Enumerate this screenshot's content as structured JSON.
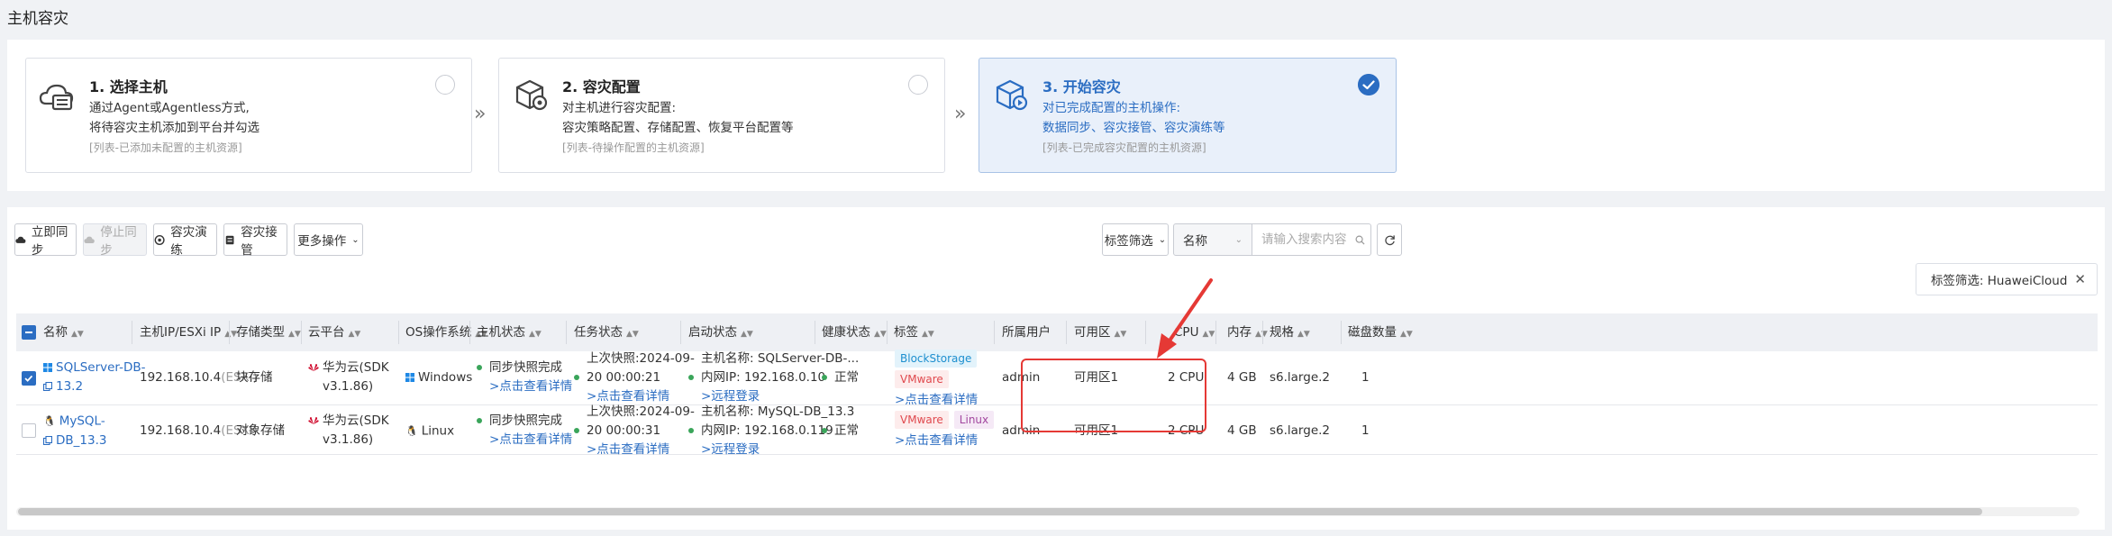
{
  "page_title": "主机容灾",
  "steps": [
    {
      "title": "1. 选择主机",
      "desc_lines": [
        "通过Agent或Agentless方式,",
        "将待容灾主机添加到平台并勾选"
      ],
      "note": "[列表-已添加未配置的主机资源]",
      "icon": "cloud-host-icon",
      "state": "unselected"
    },
    {
      "title": "2. 容灾配置",
      "desc_lines": [
        "对主机进行容灾配置:",
        "容灾策略配置、存储配置、恢复平台配置等"
      ],
      "note": "[列表-待操作配置的主机资源]",
      "icon": "box-gear-icon",
      "state": "unselected"
    },
    {
      "title": "3. 开始容灾",
      "desc_lines": [
        "对已完成配置的主机操作:",
        "数据同步、容灾接管、容灾演练等"
      ],
      "note": "[列表-已完成容灾配置的主机资源]",
      "icon": "box-play-icon",
      "state": "selected"
    }
  ],
  "toolbar": {
    "sync_now": "立即同步",
    "stop_sync": "停止同步",
    "dr_drill": "容灾演练",
    "dr_takeover": "容灾接管",
    "more_actions": "更多操作",
    "tag_filter": "标签筛选",
    "search_field": "名称",
    "search_placeholder": "请输入搜索内容",
    "tag_chip": "标签筛选:  HuaweiCloud"
  },
  "table": {
    "headers": {
      "name": "名称",
      "ip": "主机IP/ESXi IP",
      "storage": "存储类型",
      "cloud": "云平台",
      "os": "OS操作系统",
      "host_status": "主机状态",
      "task_status": "任务状态",
      "boot_status": "启动状态",
      "health": "健康状态",
      "tags": "标签",
      "owner": "所属用户",
      "zone": "可用区",
      "cpu": "CPU",
      "memory": "内存",
      "spec": "规格",
      "disks": "磁盘数量"
    },
    "rows": [
      {
        "checked": true,
        "name_line1": "SQLServer-DB-",
        "name_line2": "13.2",
        "ip": "192.168.10.4",
        "ip_suffix": "(ESXi)",
        "storage": "块存储",
        "cloud_line1": "华为云(SDK",
        "cloud_line2": "v3.1.86)",
        "os": "Windows",
        "host_status": "同步快照完成",
        "host_detail": ">点击查看详情",
        "task_line1": "上次快照:2024-09-",
        "task_line2": "20 00:00:21",
        "task_detail": ">点击查看详情",
        "boot_name": "主机名称: SQLServer-DB-...",
        "boot_ip": "内网IP: 192.168.0.10",
        "boot_link": ">远程登录",
        "health": "正常",
        "tags": [
          "BlockStorage",
          "VMware"
        ],
        "tags_detail": ">点击查看详情",
        "owner": "admin",
        "zone": "可用区1",
        "cpu": "2 CPU",
        "memory": "4 GB",
        "spec": "s6.large.2",
        "disks": "1"
      },
      {
        "checked": false,
        "name_line1": "MySQL-",
        "name_line2": "DB_13.3",
        "ip": "192.168.10.4",
        "ip_suffix": "(ESXi)",
        "storage": "对象存储",
        "cloud_line1": "华为云(SDK",
        "cloud_line2": "v3.1.86)",
        "os": "Linux",
        "host_status": "同步快照完成",
        "host_detail": ">点击查看详情",
        "task_line1": "上次快照:2024-09-",
        "task_line2": "20 00:00:31",
        "task_detail": ">点击查看详情",
        "boot_name": "主机名称: MySQL-DB_13.3",
        "boot_ip": "内网IP: 192.168.0.119",
        "boot_link": ">远程登录",
        "health": "正常",
        "tags": [
          "VMware",
          "Linux"
        ],
        "tags_detail": ">点击查看详情",
        "owner": "admin",
        "zone": "可用区1",
        "cpu": "2 CPU",
        "memory": "4 GB",
        "spec": "s6.large.2",
        "disks": "1"
      }
    ]
  },
  "colors": {
    "primary": "#2b6dc2",
    "healthy": "#3aa55a",
    "annotation": "#e53935",
    "huawei_red": "#cf0a2c"
  }
}
